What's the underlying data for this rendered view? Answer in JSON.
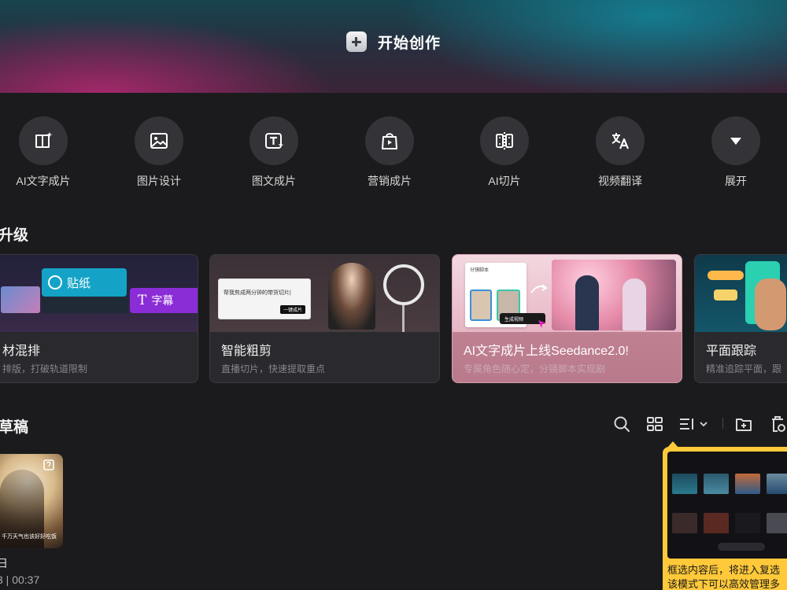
{
  "hero": {
    "title": "开始创作",
    "icon": "plus-icon"
  },
  "tools": [
    {
      "label": "AI文字成片",
      "icon": "ai-text-video-icon"
    },
    {
      "label": "图片设计",
      "icon": "image-icon"
    },
    {
      "label": "图文成片",
      "icon": "text-image-video-icon"
    },
    {
      "label": "营销成片",
      "icon": "shopping-bag-icon"
    },
    {
      "label": "AI切片",
      "icon": "ai-slice-icon"
    },
    {
      "label": "视频翻译",
      "icon": "translate-icon"
    },
    {
      "label": "展开",
      "icon": "chevron-down-icon"
    }
  ],
  "upgrades": {
    "title": "升级",
    "cards": [
      {
        "title": "材混排",
        "subtitle": "排版，打破轨道限制",
        "tag1": "贴纸",
        "tag2": "字幕"
      },
      {
        "title": "智能粗剪",
        "subtitle": "直播切片，快速提取重点",
        "overlay": "帮我剪成两分钟的带货切片|",
        "button": "一键成片"
      },
      {
        "title": "AI文字成片上线Seedance2.0!",
        "subtitle": "专属角色随心定，分镜脚本实现剧",
        "panel": "分镜脚本",
        "button": "生成视频"
      },
      {
        "title": "平面跟踪",
        "subtitle": "精准追踪平面，跟"
      }
    ]
  },
  "drafts": {
    "title": "草稿",
    "items": [
      {
        "name": "日",
        "meta": "3 | 00:37",
        "caption": "千万天气也该好好吃饭"
      }
    ],
    "tooltip": {
      "text_line1": "框选内容后，将进入复选",
      "text_line2": "该模式下可以高效管理多"
    }
  },
  "colors": {
    "accent": "#ffc93a",
    "background": "#1b1b1d",
    "card": "#2a2a2e"
  }
}
